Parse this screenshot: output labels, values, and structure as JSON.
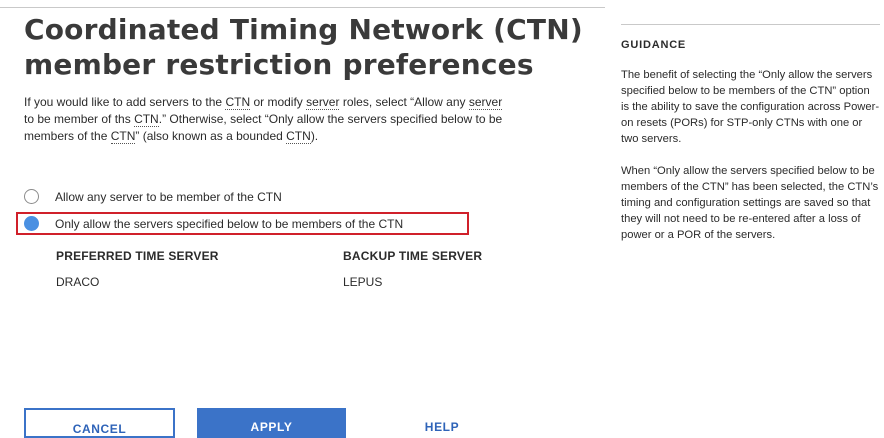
{
  "page": {
    "title": "Coordinated Timing Network (CTN) member restriction preferences",
    "intro": {
      "t1": "If you would like to add servers to the ",
      "ctn1": "CTN",
      "t2": " or modify ",
      "server1": "server",
      "t3": " roles, select “Allow any ",
      "server2": "server",
      "t4": " to be member of ths ",
      "ctn2": "CTN",
      "t5": ".” Otherwise, select “Only allow the servers specified below to be members of the ",
      "ctn3": "CTN",
      "t6": "” (also known as a bounded ",
      "ctn4": "CTN",
      "t7": ")."
    }
  },
  "options": {
    "allow_any": {
      "label": "Allow any server to be member of the CTN",
      "selected": false
    },
    "only_allow": {
      "label": "Only allow the servers specified below to be members of the CTN",
      "selected": true
    }
  },
  "servers": {
    "preferred_header": "PREFERRED TIME SERVER",
    "backup_header": "BACKUP TIME SERVER",
    "preferred_value": "DRACO",
    "backup_value": "LEPUS"
  },
  "buttons": {
    "cancel": "CANCEL",
    "apply": "APPLY",
    "help": "HELP"
  },
  "guidance": {
    "title": "GUIDANCE",
    "p1": "The benefit of selecting the “Only allow the servers specified below to be members of the CTN” option is the ability to save the configuration across Power-on resets (PORs) for STP-only CTNs with one or two servers.",
    "p2": "When “Only allow the servers specified below to be members of the CTN” has been selected, the CTN’s timing and configuration settings are saved so that they will not need to be re-entered after a loss of power or a POR of the servers."
  },
  "colors": {
    "accent": "#3b73c8",
    "radio_selected": "#4a90e2",
    "highlight_border": "#d0202a"
  }
}
